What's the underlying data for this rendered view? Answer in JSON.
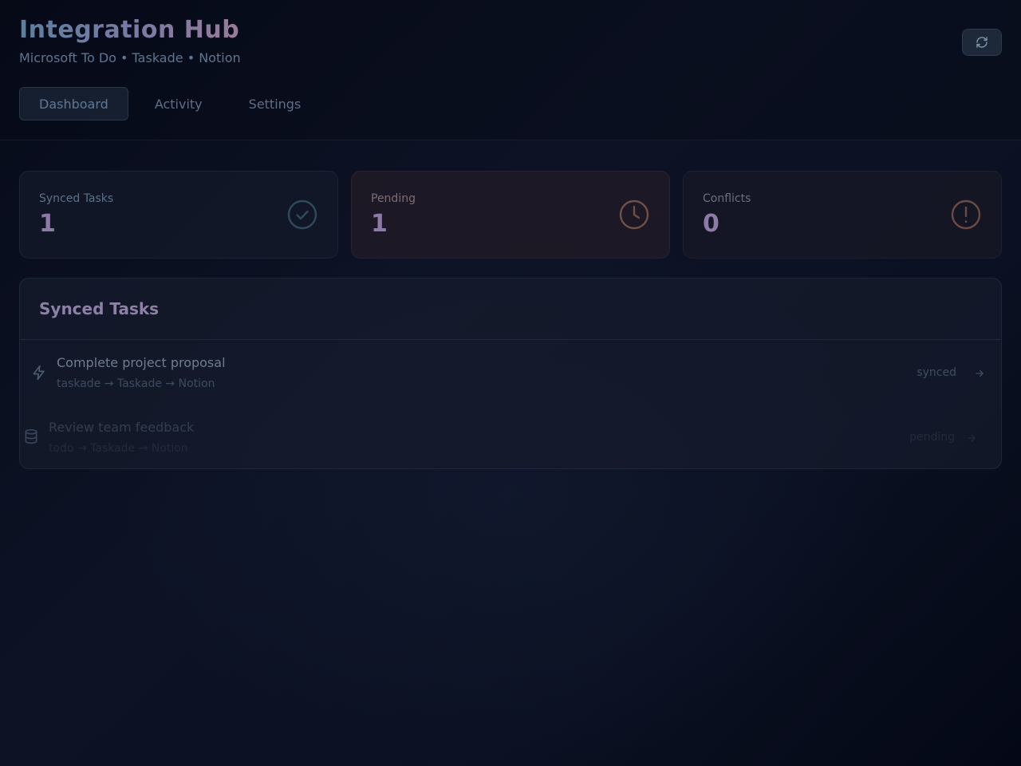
{
  "header": {
    "title": "Integration Hub",
    "subtitle": "Microsoft To Do • Taskade • Notion",
    "refresh_icon": "refresh-icon"
  },
  "tabs": [
    {
      "label": "Dashboard",
      "active": true
    },
    {
      "label": "Activity",
      "active": false
    },
    {
      "label": "Settings",
      "active": false
    }
  ],
  "stats": {
    "synced": {
      "label": "Synced Tasks",
      "value": "1",
      "icon": "check-circle-icon"
    },
    "pending": {
      "label": "Pending",
      "value": "1",
      "icon": "clock-icon"
    },
    "conflicts": {
      "label": "Conflicts",
      "value": "0",
      "icon": "alert-circle-icon"
    }
  },
  "synced_tasks": {
    "title": "Synced Tasks",
    "items": [
      {
        "title": "Complete project proposal",
        "route": "taskade → Taskade → Notion",
        "status": "synced",
        "icon": "zap-icon"
      },
      {
        "title": "Review team feedback",
        "route": "todo → Taskade → Notion",
        "status": "pending",
        "icon": "database-icon"
      }
    ]
  },
  "colors": {
    "accent_blue": "#5b7fa0",
    "accent_purple": "#8d7aa6",
    "success": "#3f5a6e",
    "warning": "#7a5a4c",
    "danger": "#74504c"
  }
}
